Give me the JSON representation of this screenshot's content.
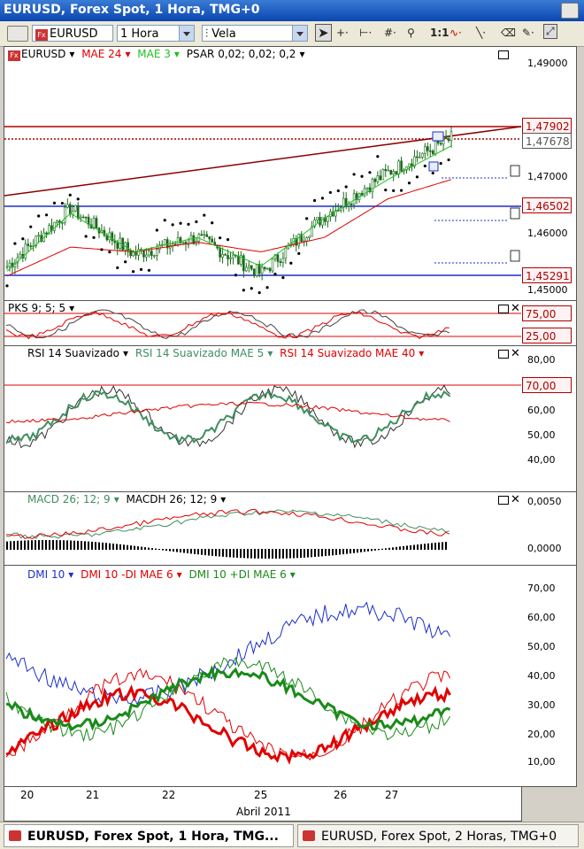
{
  "window": {
    "title": "EURUSD, Forex Spot, 1 Hora, TMG+0"
  },
  "toolbar": {
    "symbol": "EURUSD",
    "interval": "1 Hora",
    "chart_style": "Vela",
    "zoom_label": "1:1"
  },
  "panels": {
    "price": {
      "symbol_label": "EURUSD",
      "mae24": "MAE 24",
      "mae3": "MAE 3",
      "psar": "PSAR 0,02; 0,02; 0,2",
      "ticks": [
        "1,49000",
        "1,47000",
        "1,46000",
        "1,45000"
      ],
      "tags": {
        "a": "1,47902",
        "b": "1,47678",
        "c": "1,46502",
        "d": "1,45291"
      }
    },
    "pks": {
      "title": "PKS 9; 5; 5",
      "ticks": [
        "75,00",
        "25,00"
      ]
    },
    "rsi": {
      "t1": "RSI 14 Suavizado",
      "t2": "RSI 14 Suavizado MAE 5",
      "t3": "RSI 14 Suavizado MAE 40",
      "ticks": [
        "80,00",
        "70,00",
        "60,00",
        "50,00",
        "40,00"
      ]
    },
    "macd": {
      "t1": "MACD 26; 12; 9",
      "t2": "MACDH 26; 12; 9",
      "ticks": [
        "0,0050",
        "0,0000"
      ]
    },
    "dmi": {
      "t1": "DMI 10",
      "t2": "DMI 10 -DI MAE 6",
      "t3": "DMI 10 +DI MAE 6",
      "ticks": [
        "70,00",
        "60,00",
        "50,00",
        "40,00",
        "30,00",
        "20,00",
        "10,00"
      ]
    }
  },
  "xaxis": {
    "days": [
      "20",
      "21",
      "22",
      "25",
      "26",
      "27"
    ],
    "month": "Abril 2011"
  },
  "tabs": [
    "EURUSD, Forex Spot, 1 Hora, TMG...",
    "EURUSD, Forex Spot, 2 Horas, TMG+0"
  ],
  "colors": {
    "red": "#e00000",
    "green": "#1a8a1a",
    "blue": "#1c2fc8",
    "darkred": "#8b0000"
  },
  "chart_data": [
    {
      "type": "line",
      "title": "EURUSD, Forex Spot, 1 Hora",
      "ylim": [
        1.445,
        1.4975
      ],
      "x": [
        "20",
        "21",
        "22",
        "25",
        "26",
        "27"
      ],
      "series": [
        {
          "name": "EURUSD",
          "values": [
            1.452,
            1.464,
            1.4545,
            1.458,
            1.4505,
            1.4625,
            1.4715,
            1.4785
          ]
        },
        {
          "name": "MAE 24",
          "values": [
            1.45,
            1.456,
            1.455,
            1.457,
            1.455,
            1.458,
            1.466,
            1.47
          ]
        },
        {
          "name": "MAE 3",
          "values": [
            1.451,
            1.463,
            1.455,
            1.458,
            1.452,
            1.462,
            1.47,
            1.477
          ]
        }
      ],
      "levels": [
        1.47902,
        1.47678,
        1.46502,
        1.45291
      ]
    },
    {
      "type": "line",
      "title": "PKS 9; 5; 5",
      "ticks": [
        75,
        25
      ]
    },
    {
      "type": "line",
      "title": "RSI 14 Suavizado",
      "ylim": [
        30,
        85
      ],
      "reference_line": 70
    },
    {
      "type": "line",
      "title": "MACD 26; 12; 9",
      "ticks": [
        0.005,
        0.0
      ]
    },
    {
      "type": "line",
      "title": "DMI 10",
      "ylim": [
        0,
        75
      ]
    }
  ]
}
